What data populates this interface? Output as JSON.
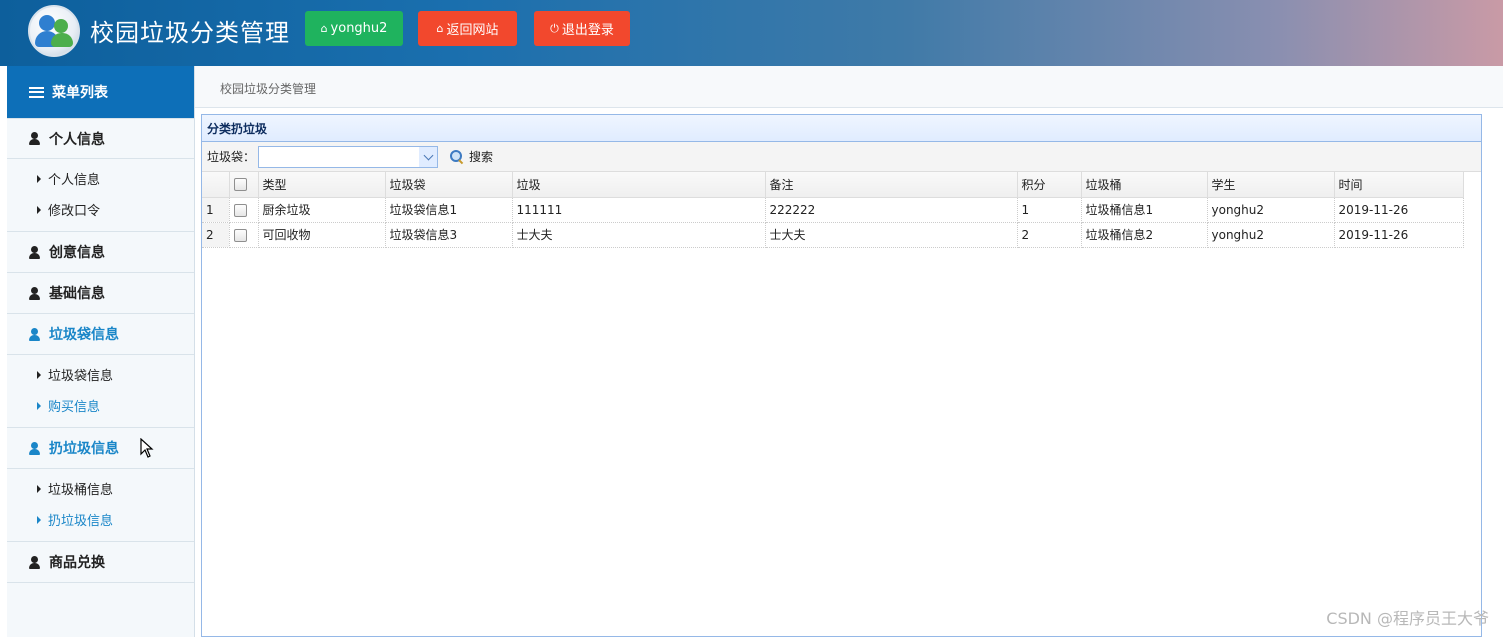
{
  "header": {
    "app_title": "校园垃圾分类管理",
    "user_button": "yonghu2",
    "back_button": "返回网站",
    "logout_button": "退出登录"
  },
  "sidebar": {
    "menu_title": "菜单列表",
    "groups": [
      {
        "label": "个人信息",
        "items": [
          "个人信息",
          "修改口令"
        ]
      },
      {
        "label": "创意信息"
      },
      {
        "label": "基础信息"
      },
      {
        "label": "垃圾袋信息",
        "items": [
          "垃圾袋信息",
          "购买信息"
        ]
      },
      {
        "label": "扔垃圾信息",
        "items": [
          "垃圾桶信息",
          "扔垃圾信息"
        ]
      },
      {
        "label": "商品兑换"
      }
    ]
  },
  "breadcrumb": "校园垃圾分类管理",
  "panel": {
    "title": "分类扔垃圾",
    "filter_label": "垃圾袋：",
    "filter_value": "",
    "search_button": "搜索"
  },
  "table": {
    "columns": [
      "类型",
      "垃圾袋",
      "垃圾",
      "备注",
      "积分",
      "垃圾桶",
      "学生",
      "时间"
    ],
    "rows": [
      {
        "num": "1",
        "cells": [
          "厨余垃圾",
          "垃圾袋信息1",
          "111111",
          "222222",
          "1",
          "垃圾桶信息1",
          "yonghu2",
          "2019-11-26"
        ]
      },
      {
        "num": "2",
        "cells": [
          "可回收物",
          "垃圾袋信息3",
          "士大夫",
          "士大夫",
          "2",
          "垃圾桶信息2",
          "yonghu2",
          "2019-11-26"
        ]
      }
    ]
  },
  "watermark": "CSDN @程序员王大爷",
  "colors": {
    "header_start": "#0d5f9c",
    "menu_head": "#0d6fb8",
    "active_link": "#1a86c8",
    "user_button": "#1fb35e",
    "danger_button": "#f2482d",
    "panel_border": "#95b8e7"
  }
}
